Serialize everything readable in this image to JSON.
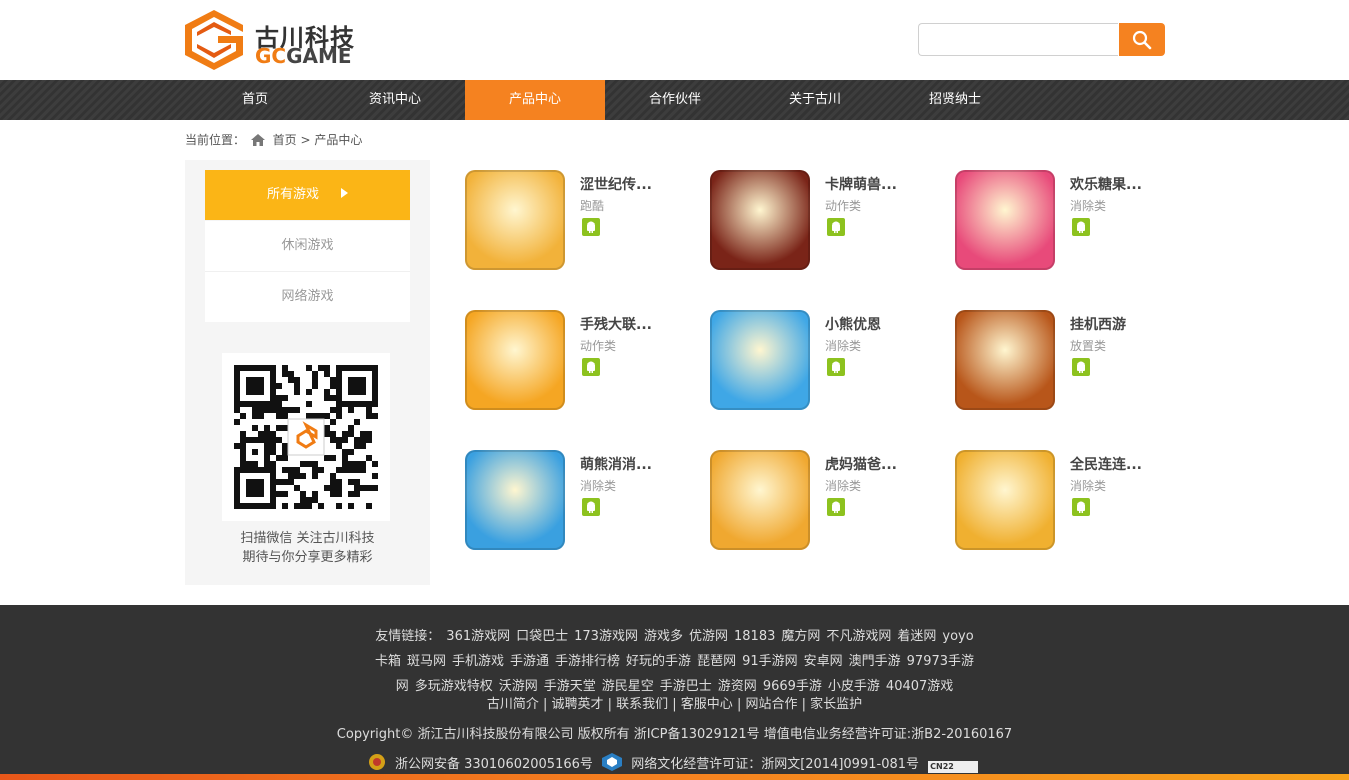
{
  "brand": {
    "name_cn": "古川科技",
    "name_en_accent": "GC",
    "name_en_rest": "GAME"
  },
  "search": {
    "placeholder": "",
    "value": ""
  },
  "nav": {
    "items": [
      {
        "label": "首页"
      },
      {
        "label": "资讯中心"
      },
      {
        "label": "产品中心"
      },
      {
        "label": "合作伙伴"
      },
      {
        "label": "关于古川"
      },
      {
        "label": "招贤纳士"
      }
    ],
    "active": "产品中心"
  },
  "breadcrumb": {
    "prefix": "当前位置：",
    "home": "首页",
    "sep": ">",
    "current": "产品中心"
  },
  "sidebar": {
    "categories": [
      {
        "label": "所有游戏"
      },
      {
        "label": "休闲游戏"
      },
      {
        "label": "网络游戏"
      }
    ],
    "qr_text_1": "扫描微信 关注古川科技",
    "qr_text_2": "期待与你分享更多精彩"
  },
  "games": [
    {
      "name": "涩世纪传...",
      "genre": "跑酷",
      "icon": "girl-avatar-icon",
      "color": "#f2b23a"
    },
    {
      "name": "卡牌萌兽...",
      "genre": "动作类",
      "icon": "monster-icon",
      "color": "#7a2418"
    },
    {
      "name": "欢乐糖果...",
      "genre": "消除类",
      "icon": "candy-icon",
      "color": "#e84a7a"
    },
    {
      "name": "手残大联...",
      "genre": "动作类",
      "icon": "face-icon",
      "color": "#f5a623"
    },
    {
      "name": "小熊优恩",
      "genre": "消除类",
      "icon": "bear-icon",
      "color": "#3fa7e6"
    },
    {
      "name": "挂机西游",
      "genre": "放置类",
      "icon": "xiyou-icon",
      "color": "#b8561a"
    },
    {
      "name": "萌熊消消...",
      "genre": "消除类",
      "icon": "bear-icon",
      "color": "#3aa0e0"
    },
    {
      "name": "虎妈猫爸...",
      "genre": "消除类",
      "icon": "tiger-girl-icon",
      "color": "#f0a830"
    },
    {
      "name": "全民连连...",
      "genre": "消除类",
      "icon": "cow-icon",
      "color": "#f0b030"
    }
  ],
  "footer": {
    "links_label": "友情链接：",
    "links_row1": [
      "361游戏网",
      "口袋巴士",
      "173游戏网",
      "游戏多",
      "优游网",
      "18183",
      "魔方网",
      "不凡游戏网",
      "着迷网",
      "yoyo"
    ],
    "links_row2": [
      "卡箱",
      "斑马网",
      "手机游戏",
      "手游通",
      "手游排行榜",
      "好玩的手游",
      "琵琶网",
      "91手游网",
      "安卓网",
      "澳門手游",
      "97973手游"
    ],
    "links_row3": [
      "网",
      "多玩游戏特权",
      "沃游网",
      "手游天堂",
      "游民星空",
      "手游巴士",
      "游资网",
      "9669手游",
      "小皮手游",
      "40407游戏"
    ],
    "about_links": "古川简介 | 诚聘英才 | 联系我们 | 客服中心 | 网站合作 | 家长监护",
    "copyright": "Copyright© 浙江古川科技股份有限公司 版权所有 浙ICP备13029121号  增值电信业务经营许可证:浙B2-20160167",
    "police": "浙公网安备 33010602005166号",
    "culture": "网络文化经营许可证：浙网文[2014]0991-081号",
    "badge": "CN22"
  },
  "colors": {
    "accent": "#f58220",
    "active_category": "#fbb516",
    "android_green": "#8dc21f",
    "nav_bg": "#3a3a3a",
    "footer_bg": "#333333"
  }
}
